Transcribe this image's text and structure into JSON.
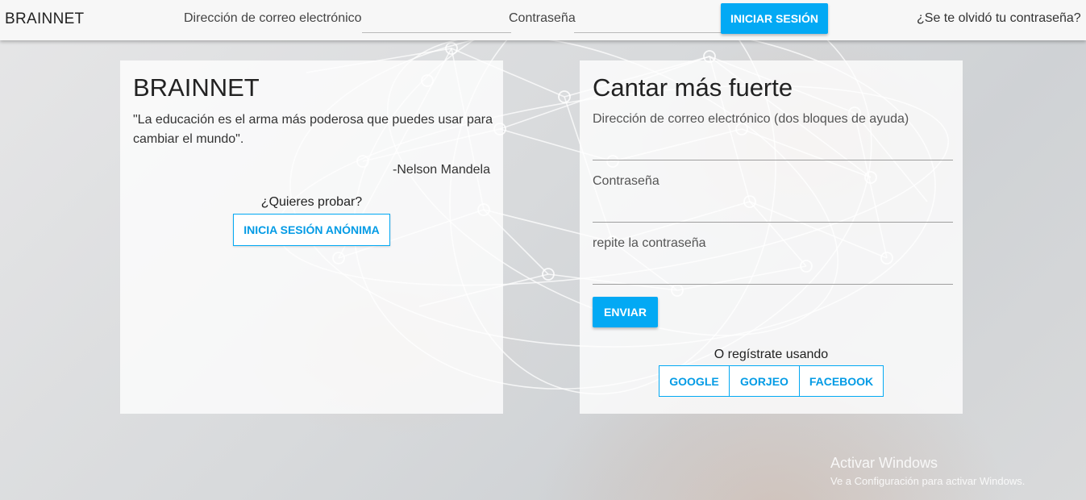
{
  "header": {
    "brand": "BRAINNET",
    "email_label": "Dirección de correo electrónico",
    "email_value": "",
    "password_label": "Contraseña",
    "password_value": "",
    "login_button": "INICIAR SESIÓN",
    "forgot_link": "¿Se te olvidó tu contraseña?"
  },
  "left_card": {
    "title": "BRAINNET",
    "quote": "\"La educación es el arma más poderosa que puedes usar para cambiar el mundo\".",
    "author": "-Nelson Mandela",
    "try_text": "¿Quieres probar?",
    "anon_button": "INICIA SESIÓN ANÓNIMA"
  },
  "right_card": {
    "title": "Cantar más fuerte",
    "email_label": "Dirección de correo electrónico (dos bloques de ayuda)",
    "password_label": "Contraseña",
    "repeat_password_label": "repite la contraseña",
    "submit_button": "ENVIAR",
    "register_text": "O regístrate usando",
    "social": {
      "google": "GOOGLE",
      "gorjeo": "GORJEO",
      "facebook": "FACEBOOK"
    }
  },
  "watermark": {
    "title": "Activar Windows",
    "subtitle": "Ve a Configuración para activar Windows."
  },
  "colors": {
    "accent": "#03a9f4",
    "topbar_bg": "#f7f7f7",
    "card_bg": "rgba(255,255,255,0.78)"
  }
}
